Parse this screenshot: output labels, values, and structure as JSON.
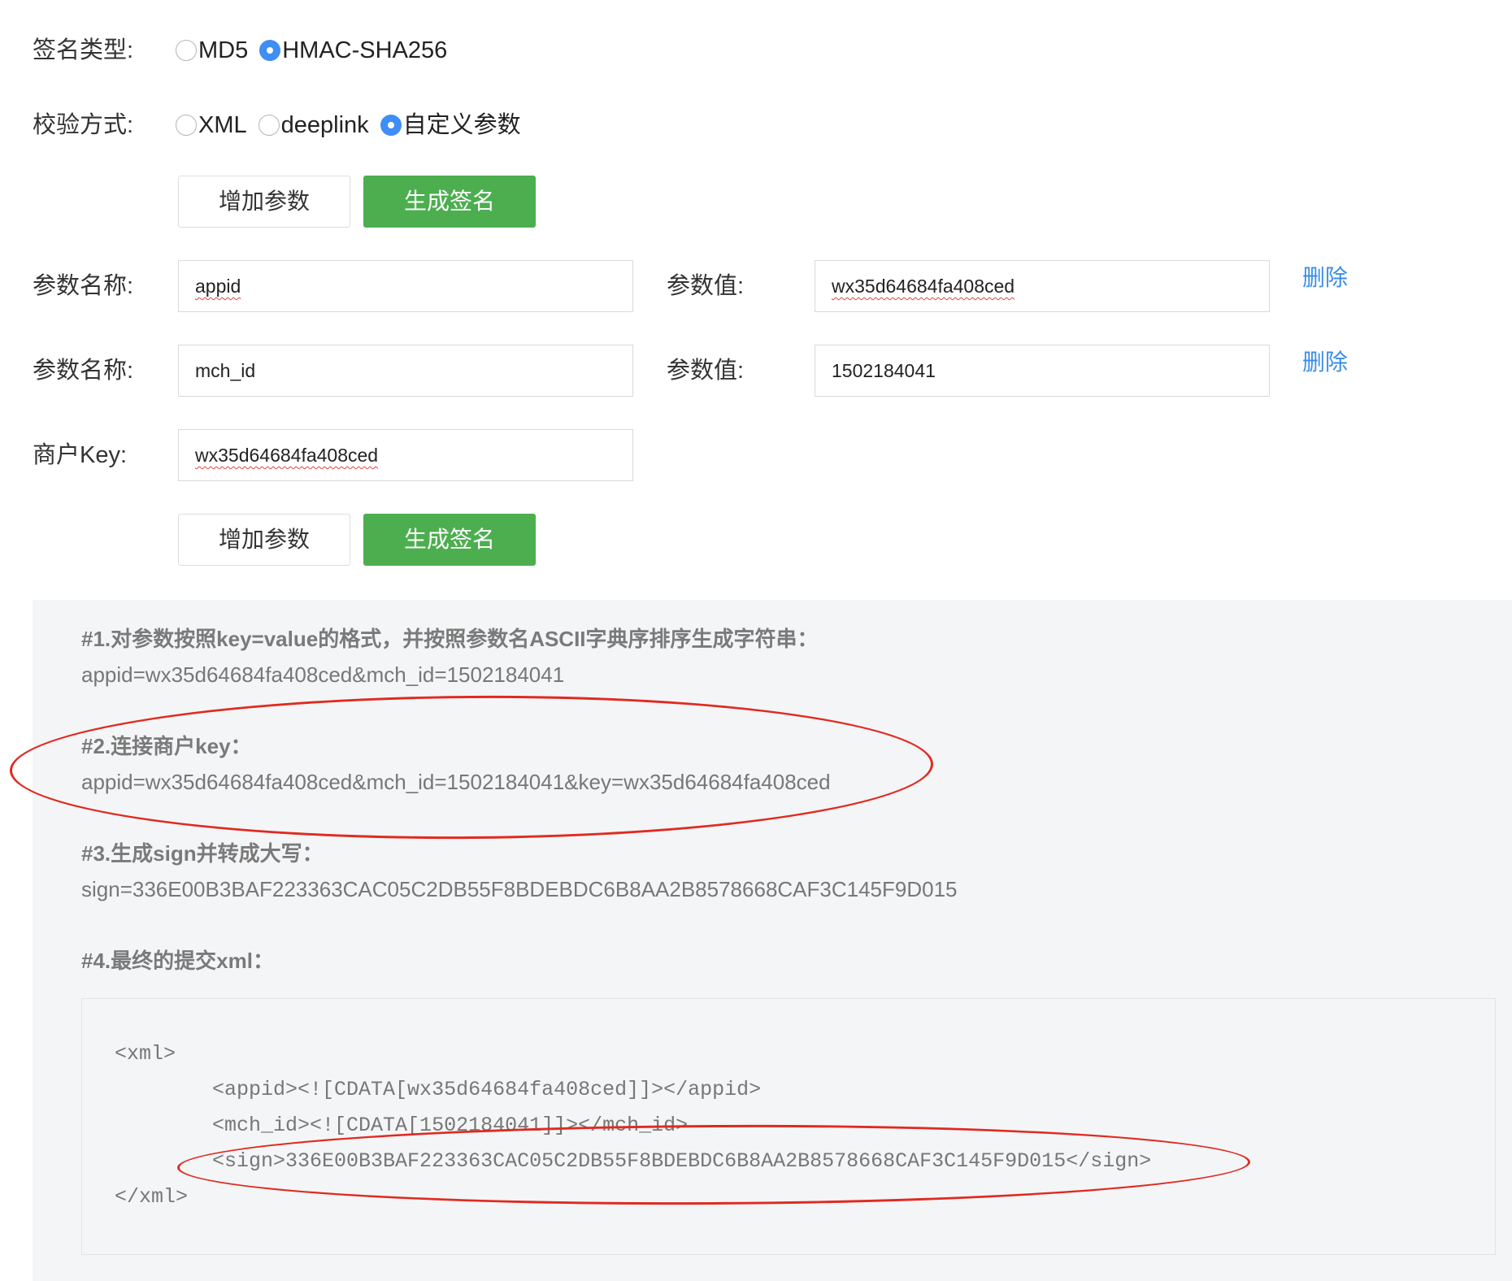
{
  "sign_type": {
    "label": "签名类型:",
    "options": [
      {
        "label": "MD5",
        "checked": false
      },
      {
        "label": "HMAC-SHA256",
        "checked": true
      }
    ]
  },
  "verify_mode": {
    "label": "校验方式:",
    "options": [
      {
        "label": "XML",
        "checked": false
      },
      {
        "label": "deeplink",
        "checked": false
      },
      {
        "label": "自定义参数",
        "checked": true
      }
    ]
  },
  "buttons": {
    "add_param": "增加参数",
    "generate_sign": "生成签名"
  },
  "params": [
    {
      "name_label": "参数名称:",
      "name": "appid",
      "value_label": "参数值:",
      "value": "wx35d64684fa408ced",
      "delete": "删除"
    },
    {
      "name_label": "参数名称:",
      "name": "mch_id",
      "value_label": "参数值:",
      "value": "1502184041",
      "delete": "删除"
    }
  ],
  "merchant_key": {
    "label": "商户Key:",
    "value": "wx35d64684fa408ced"
  },
  "steps": [
    {
      "title": "#1.对参数按照key=value的格式，并按照参数名ASCII字典序排序生成字符串：",
      "value": "appid=wx35d64684fa408ced&mch_id=1502184041"
    },
    {
      "title": "#2.连接商户key：",
      "value": "appid=wx35d64684fa408ced&mch_id=1502184041&key=wx35d64684fa408ced"
    },
    {
      "title": "#3.生成sign并转成大写：",
      "value": "sign=336E00B3BAF223363CAC05C2DB55F8BDEBDC6B8AA2B8578668CAF3C145F9D015"
    },
    {
      "title": "#4.最终的提交xml："
    }
  ],
  "xml_lines": [
    "<xml>",
    "        <appid><![CDATA[wx35d64684fa408ced]]></appid>",
    "        <mch_id><![CDATA[1502184041]]></mch_id>",
    "        <sign>336E00B3BAF223363CAC05C2DB55F8BDEBDC6B8AA2B8578668CAF3C145F9D015</sign>",
    "</xml>"
  ],
  "colors": {
    "primary_button": "#4cae4f",
    "link": "#3a8ee6",
    "radio_checked": "#3f8ef5",
    "annotation": "#e02a20",
    "result_background": "#f4f5f7"
  }
}
